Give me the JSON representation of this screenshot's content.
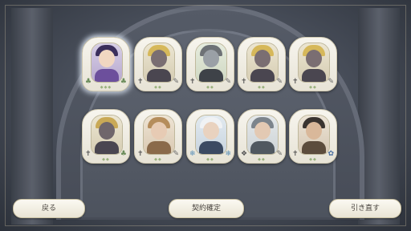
{
  "buttons": {
    "back": "戻る",
    "confirm": "契約確定",
    "redraw": "引き直す"
  },
  "cards": [
    {
      "icons": [
        "♣",
        "♣"
      ],
      "highlighted": true
    },
    {
      "icons": [
        "✝",
        "✎"
      ],
      "highlighted": false
    },
    {
      "icons": [
        "✝",
        "✎"
      ],
      "highlighted": false
    },
    {
      "icons": [
        "✝",
        "✎"
      ],
      "highlighted": false
    },
    {
      "icons": [
        "✝",
        "✎"
      ],
      "highlighted": false
    },
    {
      "icons": [
        "✝",
        "♣"
      ],
      "highlighted": false
    },
    {
      "icons": [
        "✝",
        "✎"
      ],
      "highlighted": false
    },
    {
      "icons": [
        "❄",
        "❄"
      ],
      "highlighted": false
    },
    {
      "icons": [
        "❖",
        "✎"
      ],
      "highlighted": false
    },
    {
      "icons": [
        "✝",
        "✿"
      ],
      "highlighted": false
    }
  ],
  "colors": {
    "button_bg": "#fbf9f2",
    "card_bg": "#f7f5ee",
    "glow": "#e6f0ff"
  }
}
